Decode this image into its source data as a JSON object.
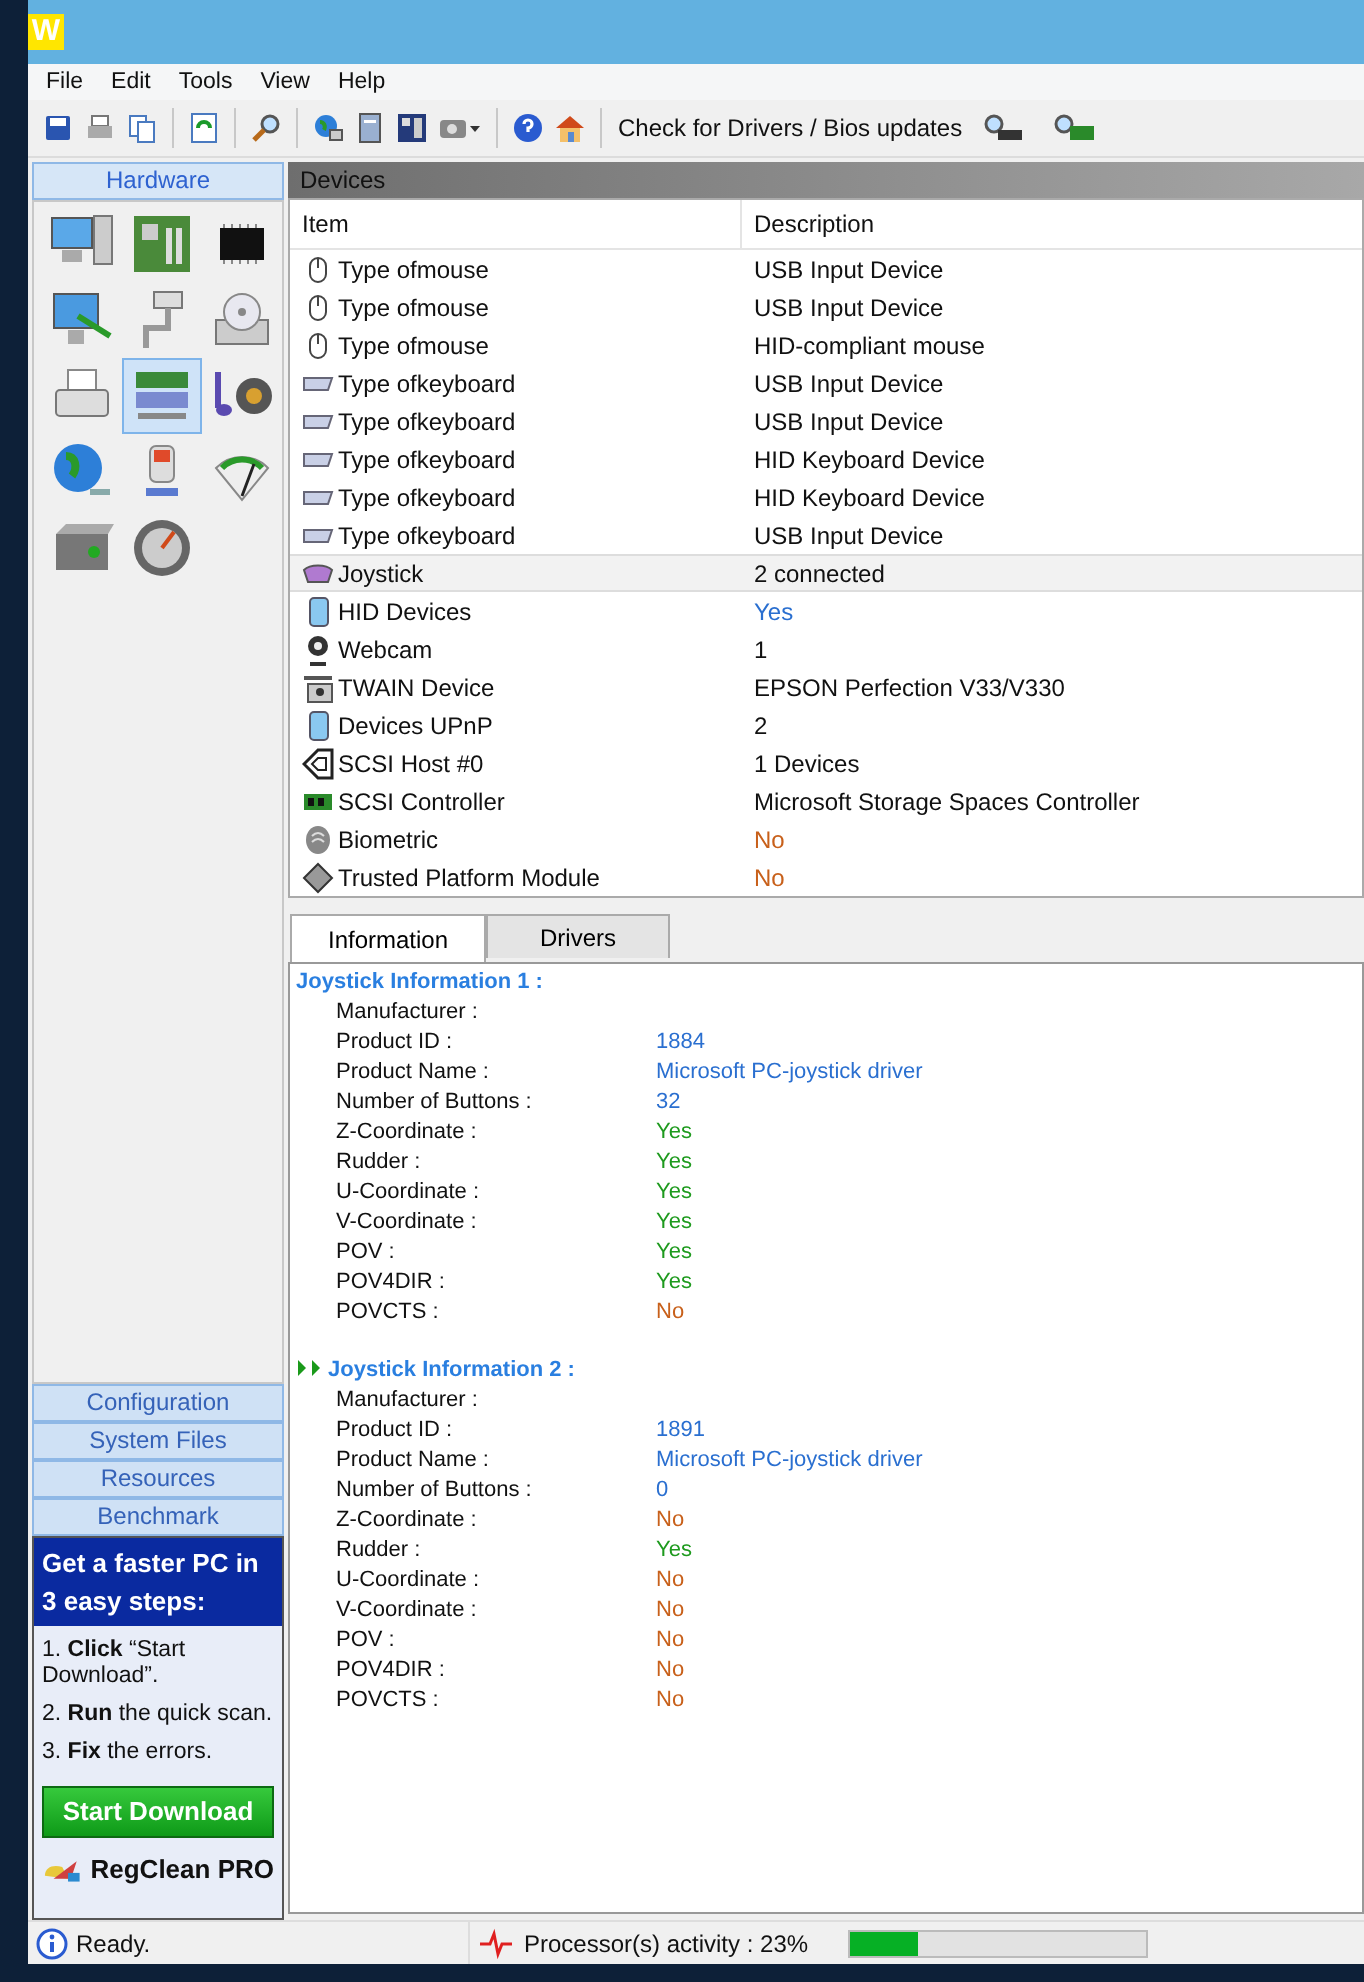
{
  "window": {
    "icon_letter": "W"
  },
  "menu": [
    "File",
    "Edit",
    "Tools",
    "View",
    "Help"
  ],
  "toolbar": {
    "buttons": [
      {
        "kind": "save"
      },
      {
        "kind": "print"
      },
      {
        "kind": "copy"
      },
      {
        "kind": "sep"
      },
      {
        "kind": "refresh"
      },
      {
        "kind": "sep"
      },
      {
        "kind": "search"
      },
      {
        "kind": "sep"
      },
      {
        "kind": "globe"
      },
      {
        "kind": "server"
      },
      {
        "kind": "board"
      },
      {
        "kind": "camera-dropdown"
      },
      {
        "kind": "sep"
      },
      {
        "kind": "help"
      },
      {
        "kind": "home"
      }
    ],
    "driver_check": {
      "label": "Check for Drivers / Bios updates",
      "buttons": [
        {
          "kind": "chip-search"
        },
        {
          "kind": "card-search"
        }
      ]
    }
  },
  "sidebar": {
    "header": {
      "label": "Hardware",
      "selected": true
    },
    "icons": [
      {
        "kind": "computer",
        "selected": false
      },
      {
        "kind": "motherboard",
        "selected": false
      },
      {
        "kind": "chip",
        "selected": false
      },
      {
        "kind": "monitor",
        "selected": false
      },
      {
        "kind": "connector",
        "selected": false
      },
      {
        "kind": "drive",
        "selected": false
      },
      {
        "kind": "printer",
        "selected": false
      },
      {
        "kind": "cards",
        "selected": true
      },
      {
        "kind": "speaker",
        "selected": false
      },
      {
        "kind": "globe",
        "selected": false
      },
      {
        "kind": "battery",
        "selected": false
      },
      {
        "kind": "meter",
        "selected": false
      },
      {
        "kind": "psu",
        "selected": false
      },
      {
        "kind": "dial",
        "selected": false
      }
    ],
    "sections": [
      {
        "label": "Configuration",
        "selected": false
      },
      {
        "label": "System Files",
        "selected": false
      },
      {
        "label": "Resources",
        "selected": false
      },
      {
        "label": "Benchmark",
        "selected": false
      }
    ]
  },
  "ad": {
    "title": "Get a faster PC in 3 easy steps:",
    "steps": [
      "1. **Click** “Start Download”.",
      "2. **Run** the quick scan.",
      "3. **Fix**  the errors."
    ],
    "button": "Start Download",
    "brand": "RegClean PRO"
  },
  "devices": {
    "title": "Devices",
    "columns": [
      "Item",
      "Description"
    ],
    "rows": [
      {
        "kind": "mouse",
        "item": "Type ofmouse",
        "description": "USB Input Device",
        "selected": false
      },
      {
        "kind": "mouse",
        "item": "Type ofmouse",
        "description": "USB Input Device",
        "selected": false
      },
      {
        "kind": "mouse",
        "item": "Type ofmouse",
        "description": "HID-compliant mouse",
        "selected": false
      },
      {
        "kind": "keyboard",
        "item": "Type ofkeyboard",
        "description": "USB Input Device",
        "selected": false
      },
      {
        "kind": "keyboard",
        "item": "Type ofkeyboard",
        "description": "USB Input Device",
        "selected": false
      },
      {
        "kind": "keyboard",
        "item": "Type ofkeyboard",
        "description": "HID Keyboard Device",
        "selected": false
      },
      {
        "kind": "keyboard",
        "item": "Type ofkeyboard",
        "description": "HID Keyboard Device",
        "selected": false
      },
      {
        "kind": "keyboard",
        "item": "Type ofkeyboard",
        "description": "USB Input Device",
        "selected": false
      },
      {
        "kind": "joystick",
        "item": "Joystick",
        "description": "2 connected",
        "selected": true
      },
      {
        "kind": "hid",
        "item": "HID Devices",
        "description": "Yes",
        "color": "#2a6fd0",
        "selected": false
      },
      {
        "kind": "webcam",
        "item": "Webcam",
        "description": "1",
        "selected": false
      },
      {
        "kind": "scanner",
        "item": "TWAIN Device",
        "description": "EPSON Perfection V33/V330",
        "selected": false
      },
      {
        "kind": "hid",
        "item": "Devices UPnP",
        "description": "2",
        "selected": false
      },
      {
        "kind": "scsi",
        "item": "SCSI Host #0",
        "description": "1 Devices",
        "selected": false
      },
      {
        "kind": "controller",
        "item": "SCSI Controller",
        "description": "Microsoft Storage Spaces Controller",
        "selected": false
      },
      {
        "kind": "fingerprint",
        "item": "Biometric",
        "description": "No",
        "color": "#c8601a",
        "selected": false
      },
      {
        "kind": "module",
        "item": "Trusted Platform Module",
        "description": "No",
        "color": "#c8601a",
        "selected": false
      }
    ]
  },
  "tabs": [
    {
      "label": "Information",
      "selected": true
    },
    {
      "label": "Drivers",
      "selected": false
    }
  ],
  "information": [
    {
      "title": "Joystick Information 1 :",
      "marked": false,
      "fields": [
        {
          "label": "Manufacturer :"
        },
        {
          "label": "Product ID :",
          "value": "1884",
          "color": "#2a6fd0"
        },
        {
          "label": "Product Name :",
          "value": "Microsoft PC-joystick driver",
          "color": "#2a6fd0"
        },
        {
          "label": "Number of Buttons :",
          "value": "32",
          "color": "#2a6fd0"
        },
        {
          "label": "Z-Coordinate :",
          "value": "Yes",
          "color": "#1e9a1e"
        },
        {
          "label": "Rudder :",
          "value": "Yes",
          "color": "#1e9a1e"
        },
        {
          "label": "U-Coordinate :",
          "value": "Yes",
          "color": "#1e9a1e"
        },
        {
          "label": "V-Coordinate :",
          "value": "Yes",
          "color": "#1e9a1e"
        },
        {
          "label": "POV :",
          "value": "Yes",
          "color": "#1e9a1e"
        },
        {
          "label": "POV4DIR :",
          "value": "Yes",
          "color": "#1e9a1e"
        },
        {
          "label": "POVCTS :",
          "value": "No",
          "color": "#c8601a"
        }
      ]
    },
    {
      "title": "Joystick Information 2 :",
      "marked": true,
      "fields": [
        {
          "label": "Manufacturer :"
        },
        {
          "label": "Product ID :",
          "value": "1891",
          "color": "#2a6fd0"
        },
        {
          "label": "Product Name :",
          "value": "Microsoft PC-joystick driver",
          "color": "#2a6fd0"
        },
        {
          "label": "Number of Buttons :",
          "value": "0",
          "color": "#2a6fd0"
        },
        {
          "label": "Z-Coordinate :",
          "value": "No",
          "color": "#c8601a"
        },
        {
          "label": "Rudder :",
          "value": "Yes",
          "color": "#1e9a1e"
        },
        {
          "label": "U-Coordinate :",
          "value": "No",
          "color": "#c8601a"
        },
        {
          "label": "V-Coordinate :",
          "value": "No",
          "color": "#c8601a"
        },
        {
          "label": "POV :",
          "value": "No",
          "color": "#c8601a"
        },
        {
          "label": "POV4DIR :",
          "value": "No",
          "color": "#c8601a"
        },
        {
          "label": "POVCTS :",
          "value": "No",
          "color": "#c8601a"
        }
      ]
    }
  ],
  "status_bar": {
    "text": "Ready.",
    "activity": "Processor(s) activity : 23%",
    "level": 0.23
  }
}
